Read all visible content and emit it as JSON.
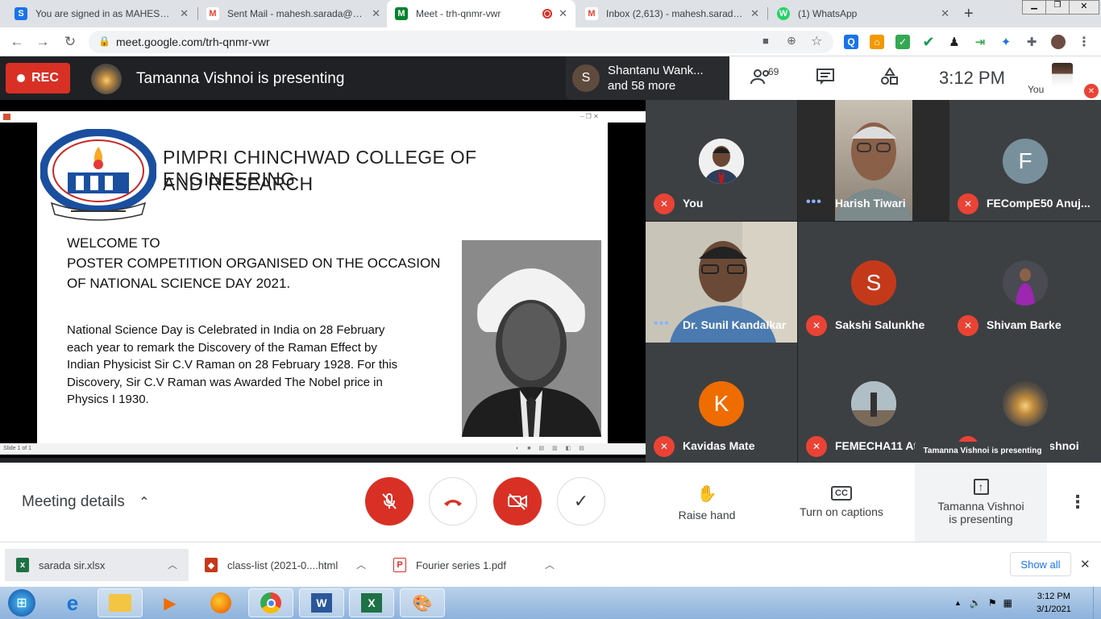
{
  "browser": {
    "tabs": [
      {
        "title": "You are signed in as MAHESHSA",
        "favicon": "S",
        "color": "#1a73e8"
      },
      {
        "title": "Sent Mail - mahesh.sarada@pcc",
        "favicon": "M",
        "color": "#ea4335"
      },
      {
        "title": "Meet - trh-qnmr-vwr",
        "favicon": "M",
        "color": "#00832d",
        "active": true
      },
      {
        "title": "Inbox (2,613) - mahesh.sarada@",
        "favicon": "M",
        "color": "#ea4335"
      },
      {
        "title": "(1) WhatsApp",
        "favicon": "W",
        "color": "#25d366"
      }
    ],
    "url": "meet.google.com/trh-qnmr-vwr"
  },
  "meet": {
    "rec": "REC",
    "presenting_title": "Tamanna Vishnoi is presenting",
    "pinned_initial": "S",
    "pinned_line1": "Shantanu Wank...",
    "pinned_line2": "and 58 more",
    "participant_count": "69",
    "time": "3:12 PM",
    "you_label": "You"
  },
  "slide": {
    "college_line1": "PIMPRI CHINCHWAD COLLEGE OF ENGINEERING",
    "college_line2": "AND RESEARCH",
    "welcome1": "WELCOME TO",
    "welcome2": "POSTER COMPETITION  ORGANISED ON THE OCCASION",
    "welcome3": "OF NATIONAL  SCIENCE DAY 2021.",
    "body1": "National Science Day is Celebrated in India on 28 February",
    "body2": "each year to remark the Discovery of the Raman Effect by",
    "body3": "Indian Physicist Sir C.V Raman on 28 February 1928. For  this",
    "body4": "Discovery, Sir C.V Raman was Awarded The Nobel price in",
    "body5": "Physics I 1930.",
    "status": "Slide 1 of 1"
  },
  "participants": [
    {
      "name": "You",
      "muted": true,
      "type": "photo"
    },
    {
      "name": "Harish Tiwari",
      "muted": false,
      "type": "video"
    },
    {
      "name": "FECompE50 Anuj...",
      "muted": true,
      "initial": "F",
      "color": "#78909c"
    },
    {
      "name": "Dr. Sunil Kandalkar",
      "muted": false,
      "type": "video"
    },
    {
      "name": "Sakshi Salunkhe",
      "muted": true,
      "initial": "S",
      "color": "#c5391b"
    },
    {
      "name": "Shivam Barke",
      "muted": true,
      "type": "photo"
    },
    {
      "name": "Kavidas Mate",
      "muted": true,
      "initial": "K",
      "color": "#ef6c00"
    },
    {
      "name": "FEMECHA11 At...",
      "muted": true,
      "type": "photo"
    },
    {
      "name": "Tamanna Vishnoi",
      "muted": true,
      "type": "photo"
    }
  ],
  "tooltip": "Tamanna Vishnoi is presenting",
  "controls": {
    "meeting_details": "Meeting details",
    "raise_hand": "Raise hand",
    "captions": "Turn on captions",
    "presenting_line1": "Tamanna Vishnoi",
    "presenting_line2": "is presenting"
  },
  "downloads": [
    {
      "name": "sarada sir.xlsx",
      "color": "#1e7145"
    },
    {
      "name": "class-list (2021-0....html",
      "color": "#c5391b"
    },
    {
      "name": "Fourier series 1.pdf",
      "color": "#d93025"
    }
  ],
  "show_all": "Show all",
  "taskbar": {
    "time": "3:12 PM",
    "date": "3/1/2021"
  }
}
